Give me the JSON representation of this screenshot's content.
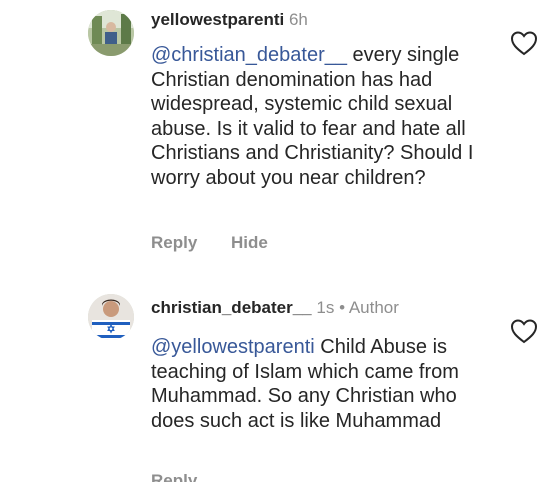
{
  "comments": [
    {
      "username": "yellowestparenti",
      "time": "6h",
      "mention": "@christian_debater__",
      "text": " every single Christian denomination has had widespread, systemic child sexual abuse. Is it valid to fear and hate all Christians and Christianity? Should I worry about you near children?",
      "actions": {
        "reply": "Reply",
        "hide": "Hide"
      },
      "avatar_icon": "profile-photo"
    },
    {
      "username": "christian_debater__",
      "time": "1s",
      "separator": "•",
      "role": "Author",
      "mention": "@yellowestparenti",
      "text": " Child Abuse is teaching of Islam which came from Muhammad. So any Christian who does such act is like Muhammad",
      "actions": {
        "reply": "Reply"
      },
      "avatar_icon": "profile-photo-israel-flag"
    }
  ],
  "icons": {
    "like": "heart-outline-icon"
  },
  "colors": {
    "mention": "#385898",
    "text": "#262626",
    "secondary": "#8e8e8e",
    "background": "#ffffff"
  }
}
